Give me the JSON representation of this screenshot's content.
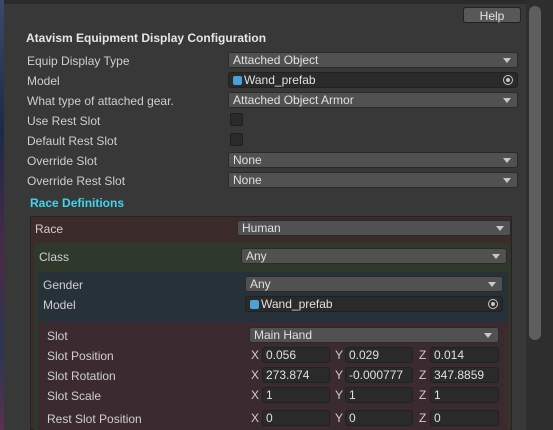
{
  "header": {
    "help_label": "Help"
  },
  "title": "Atavism Equipment Display Configuration",
  "fields": {
    "equip_display_type": {
      "label": "Equip Display Type",
      "value": "Attached Object"
    },
    "model": {
      "label": "Model",
      "value": "Wand_prefab"
    },
    "attached_gear_type": {
      "label": "What type of attached gear.",
      "value": "Attached Object Armor"
    },
    "use_rest_slot": {
      "label": "Use Rest Slot",
      "checked": false
    },
    "default_rest_slot": {
      "label": "Default Rest Slot",
      "checked": false
    },
    "override_slot": {
      "label": "Override Slot",
      "value": "None"
    },
    "override_rest_slot": {
      "label": "Override Rest Slot",
      "value": "None"
    }
  },
  "race_definitions": {
    "title": "Race Definitions",
    "race": {
      "label": "Race",
      "value": "Human"
    },
    "class": {
      "label": "Class",
      "value": "Any"
    },
    "gender": {
      "label": "Gender",
      "value": "Any"
    },
    "model": {
      "label": "Model",
      "value": "Wand_prefab"
    },
    "slot": {
      "label": "Slot",
      "value": "Main Hand"
    },
    "slot_position": {
      "label": "Slot Position",
      "x": "0.056",
      "y": "0.029",
      "z": "0.014"
    },
    "slot_rotation": {
      "label": "Slot Rotation",
      "x": "273.874",
      "y": "-0.000777",
      "z": "347.8859"
    },
    "slot_scale": {
      "label": "Slot Scale",
      "x": "1",
      "y": "1",
      "z": "1"
    },
    "rest_slot_position": {
      "label": "Rest Slot Position",
      "x": "0",
      "y": "0",
      "z": "0"
    }
  },
  "axes": {
    "x": "X",
    "y": "Y",
    "z": "Z"
  },
  "colors": {
    "section_title": "#3fd6ee",
    "prefab_icon": "#4aa0d8"
  }
}
